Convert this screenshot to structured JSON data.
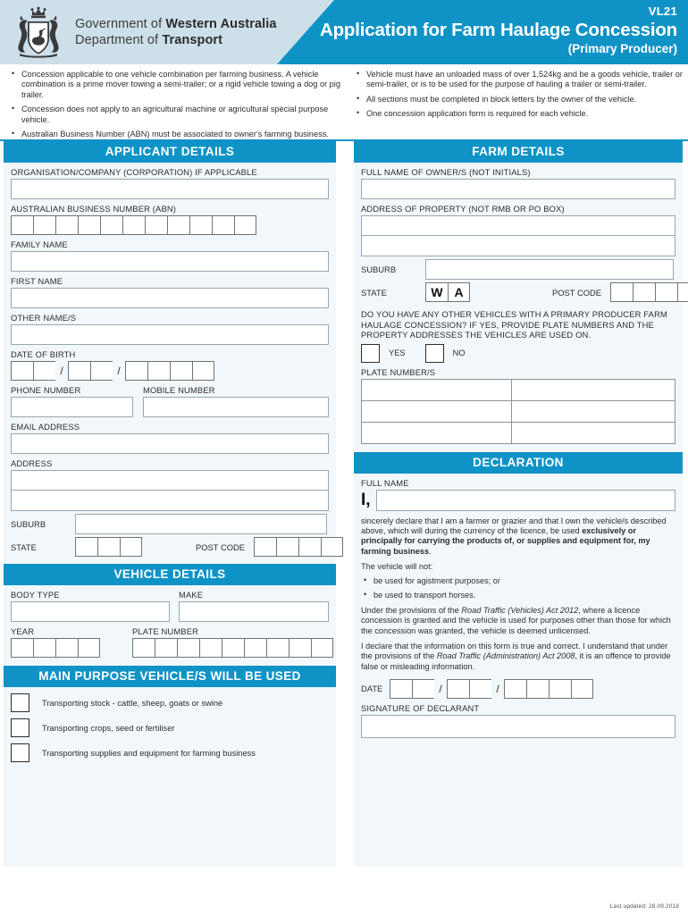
{
  "header": {
    "gov_line1_plain": "Government of ",
    "gov_line1_bold": "Western Australia",
    "gov_line2_plain": "Department of ",
    "gov_line2_bold": "Transport",
    "form_code": "VL21",
    "title": "Application for Farm Haulage Concession",
    "subtitle": "(Primary Producer)",
    "crest_name": "wa-government-crest",
    "accent_color": "#0f93c6",
    "header_bg_color": "#cddfe9"
  },
  "intro": {
    "left_bullets": [
      "Concession applicable to one vehicle combination per farming business. A vehicle combination is a prime mover towing a semi-trailer; or a rigid vehicle towing a dog or pig trailer.",
      "Concession does not apply to an agricultural machine or agricultural special purpose vehicle.",
      "Australian Business Number (ABN) must be associated to owner's farming business."
    ],
    "right_bullets": [
      "Vehicle must have an unloaded mass of over 1,524kg and be a goods vehicle, trailer or semi-trailer, or is to be used for the purpose of hauling a trailer or semi-trailer.",
      "All sections must be completed in block letters by the owner of the vehicle.",
      "One concession application form is required for each vehicle."
    ]
  },
  "applicant": {
    "section_title": "APPLICANT DETAILS",
    "organisation_label": "ORGANISATION/COMPANY (CORPORATION) IF APPLICABLE",
    "organisation_value": "",
    "abn_label": "AUSTRALIAN BUSINESS NUMBER (ABN)",
    "abn_cells": 11,
    "family_name_label": "FAMILY NAME",
    "family_name_value": "",
    "first_name_label": "FIRST NAME",
    "first_name_value": "",
    "other_names_label": "OTHER NAME/S",
    "other_names_value": "",
    "dob_label": "DATE OF BIRTH",
    "dob_day_cells": 2,
    "dob_month_cells": 2,
    "dob_year_cells": 4,
    "dob_separator": "/",
    "phone_label": "PHONE NUMBER",
    "phone_value": "",
    "mobile_label": "MOBILE NUMBER",
    "mobile_value": "",
    "email_label": "EMAIL ADDRESS",
    "email_value": "",
    "address_label": "ADDRESS",
    "address_line1_value": "",
    "address_line2_value": "",
    "suburb_label": "SUBURB",
    "suburb_value": "",
    "state_label": "STATE",
    "state_cells": 3,
    "postcode_label": "POST CODE",
    "postcode_cells": 4
  },
  "vehicle": {
    "section_title": "VEHICLE DETAILS",
    "body_type_label": "BODY TYPE",
    "body_type_value": "",
    "make_label": "MAKE",
    "make_value": "",
    "year_label": "YEAR",
    "year_cells": 4,
    "plate_label": "PLATE NUMBER",
    "plate_cells": 9
  },
  "main_purpose": {
    "section_title": "MAIN PURPOSE VEHICLE/S WILL BE USED",
    "options": [
      "Transporting stock - cattle, sheep, goats or swine",
      "Transporting crops, seed or fertiliser",
      "Transporting supplies and equipment for farming business"
    ]
  },
  "farm": {
    "section_title": "FARM DETAILS",
    "owner_label": "FULL NAME OF OWNER/S (NOT INITIALS)",
    "owner_value": "",
    "property_address_label": "ADDRESS OF PROPERTY (NOT RMB OR PO BOX)",
    "property_line1_value": "",
    "property_line2_value": "",
    "suburb_label": "SUBURB",
    "suburb_value": "",
    "state_label": "STATE",
    "state_prefilled": [
      "W",
      "A"
    ],
    "postcode_label": "POST CODE",
    "postcode_cells": 4,
    "other_vehicles_question": "DO YOU HAVE ANY OTHER VEHICLES WITH A PRIMARY PRODUCER FARM HAULAGE CONCESSION? IF YES, PROVIDE PLATE NUMBERS AND THE PROPERTY ADDRESSES THE VEHICLES ARE USED ON.",
    "yes_label": "YES",
    "no_label": "NO",
    "plate_numbers_label": "PLATE NUMBER/S",
    "plate_table_rows": 3,
    "plate_table_cols": 2
  },
  "declaration": {
    "section_title": "DECLARATION",
    "full_name_label": "FULL NAME",
    "full_name_value": "",
    "i_glyph": "I,",
    "para1_plain_a": "sincerely declare that I am a farmer or grazier and that I own the vehicle/s described above, which will during the currency of the licence, be used ",
    "para1_bold": "exclusively or principally for carrying the products of, or supplies and equipment for, my farming business",
    "para1_plain_b": ".",
    "vehicle_will_not_label": "The vehicle will not:",
    "will_not_bullets": [
      "be used for agistment purposes; or",
      "be used to transport horses."
    ],
    "para2_a": "Under the provisions of the ",
    "para2_italic": "Road Traffic (Vehicles) Act 2012",
    "para2_b": ", where a licence concession is granted and the vehicle is used for purposes other than those for which the concession was granted, the vehicle is deemed unlicensed.",
    "para3_a": "I declare that the information on this form is true and correct. I understand that under the provisions of the ",
    "para3_italic": "Road Traffic (Administration) Act 2008",
    "para3_b": ", it is an offence to provide false or misleading information.",
    "date_label": "DATE",
    "date_day_cells": 2,
    "date_month_cells": 2,
    "date_year_cells": 4,
    "date_separator": "/",
    "signature_label": "SIGNATURE OF DECLARANT",
    "signature_value": ""
  },
  "footer": {
    "last_updated": "Last updated: 28.09.2018"
  }
}
